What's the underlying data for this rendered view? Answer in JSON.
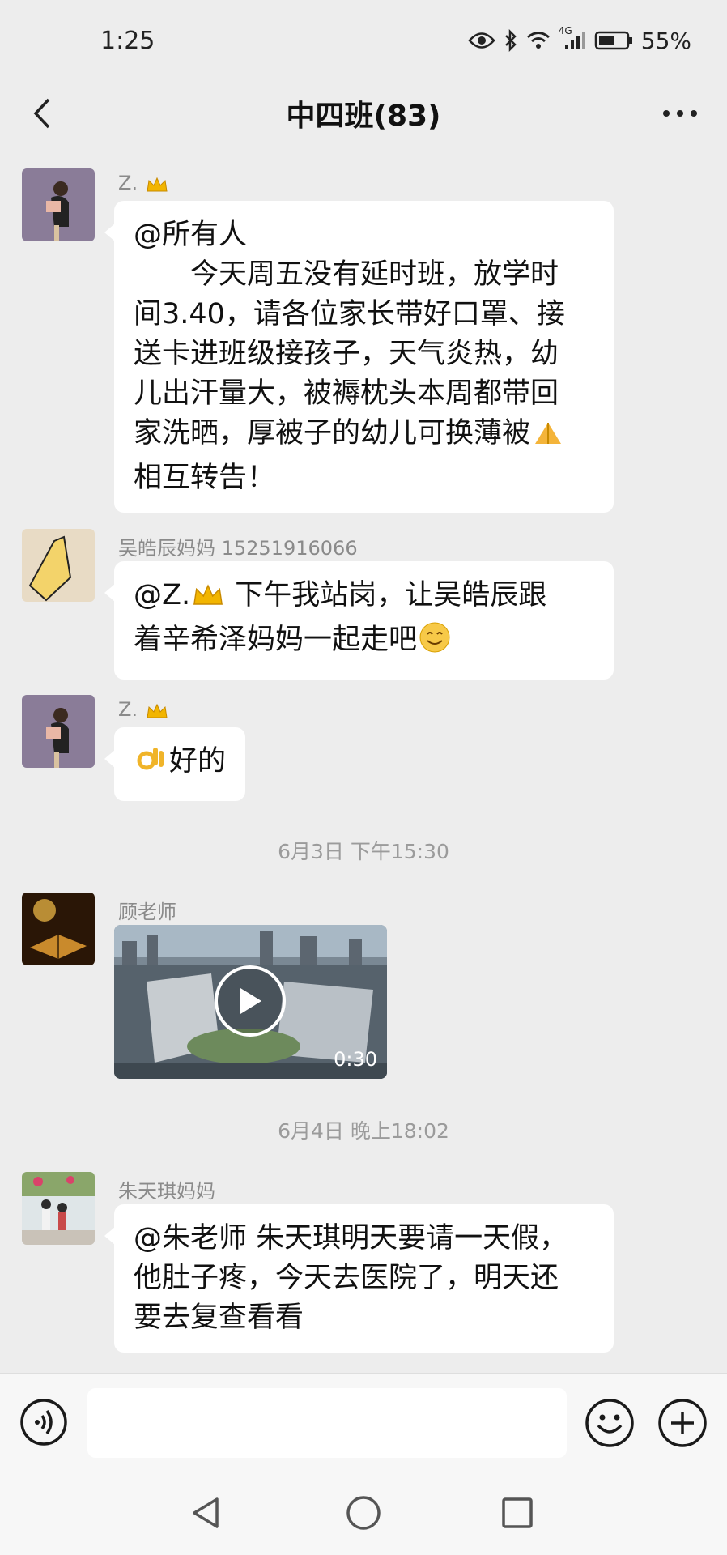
{
  "status_bar": {
    "time": "1:25",
    "network": "4G",
    "battery": "55%"
  },
  "header": {
    "title": "中四班(83)"
  },
  "messages": [
    {
      "sender": "Z.",
      "lines": [
        "@所有人",
        "今天周五没有延时班，放学时",
        "间3.40，请各位家长带好口罩、接",
        "送卡进班级接孩子，天气炎热，幼",
        "儿出汗量大，被褥枕头本周都带回",
        "家洗晒，厚被子的幼儿可换薄被",
        "相互转告！"
      ]
    },
    {
      "sender": "吴皓辰妈妈 15251916066",
      "lines": [
        "@Z.",
        "下午我站岗，让吴皓辰跟",
        "着辛希泽妈妈一起走吧"
      ]
    },
    {
      "sender": "Z.",
      "lines": [
        "好的"
      ]
    },
    {
      "sender": "顾老师",
      "video_duration": "0:30"
    },
    {
      "sender": "朱天琪妈妈",
      "lines": [
        "@朱老师  朱天琪明天要请一天假，",
        "他肚子疼，今天去医院了，明天还",
        "要去复查看看"
      ]
    }
  ],
  "dividers": [
    "6月3日 下午15:30",
    "6月4日 晚上18:02"
  ],
  "input": {
    "placeholder": ""
  },
  "colors": {
    "background": "#ededed",
    "bubble": "#ffffff",
    "timestamp": "#9b9b9b"
  }
}
